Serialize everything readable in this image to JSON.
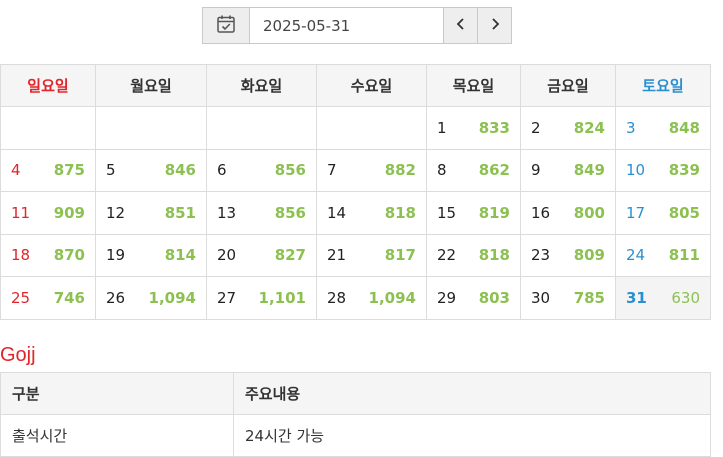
{
  "datepicker": {
    "date": "2025-05-31",
    "calendar_icon": "calendar-check-icon",
    "prev_icon": "chevron-left-icon",
    "next_icon": "chevron-right-icon"
  },
  "calendar": {
    "weekdays": [
      "일요일",
      "월요일",
      "화요일",
      "수요일",
      "목요일",
      "금요일",
      "토요일"
    ],
    "weeks": [
      [
        null,
        null,
        null,
        null,
        {
          "day": "1",
          "count": "833"
        },
        {
          "day": "2",
          "count": "824"
        },
        {
          "day": "3",
          "count": "848"
        }
      ],
      [
        {
          "day": "4",
          "count": "875"
        },
        {
          "day": "5",
          "count": "846"
        },
        {
          "day": "6",
          "count": "856"
        },
        {
          "day": "7",
          "count": "882"
        },
        {
          "day": "8",
          "count": "862"
        },
        {
          "day": "9",
          "count": "849"
        },
        {
          "day": "10",
          "count": "839"
        }
      ],
      [
        {
          "day": "11",
          "count": "909"
        },
        {
          "day": "12",
          "count": "851"
        },
        {
          "day": "13",
          "count": "856"
        },
        {
          "day": "14",
          "count": "818"
        },
        {
          "day": "15",
          "count": "819"
        },
        {
          "day": "16",
          "count": "800"
        },
        {
          "day": "17",
          "count": "805"
        }
      ],
      [
        {
          "day": "18",
          "count": "870"
        },
        {
          "day": "19",
          "count": "814"
        },
        {
          "day": "20",
          "count": "827"
        },
        {
          "day": "21",
          "count": "817"
        },
        {
          "day": "22",
          "count": "818"
        },
        {
          "day": "23",
          "count": "809"
        },
        {
          "day": "24",
          "count": "811"
        }
      ],
      [
        {
          "day": "25",
          "count": "746"
        },
        {
          "day": "26",
          "count": "1,094"
        },
        {
          "day": "27",
          "count": "1,101"
        },
        {
          "day": "28",
          "count": "1,094"
        },
        {
          "day": "29",
          "count": "803"
        },
        {
          "day": "30",
          "count": "785"
        },
        {
          "day": "31",
          "count": "630"
        }
      ]
    ],
    "today": "31",
    "colors": {
      "sunday": "#e0252b",
      "saturday": "#2a8fd0",
      "count": "#8cc152"
    }
  },
  "section": {
    "title": "Gojj"
  },
  "info_table": {
    "headers": [
      "구분",
      "주요내용"
    ],
    "rows": [
      [
        "출석시간",
        "24시간 가능"
      ]
    ]
  }
}
